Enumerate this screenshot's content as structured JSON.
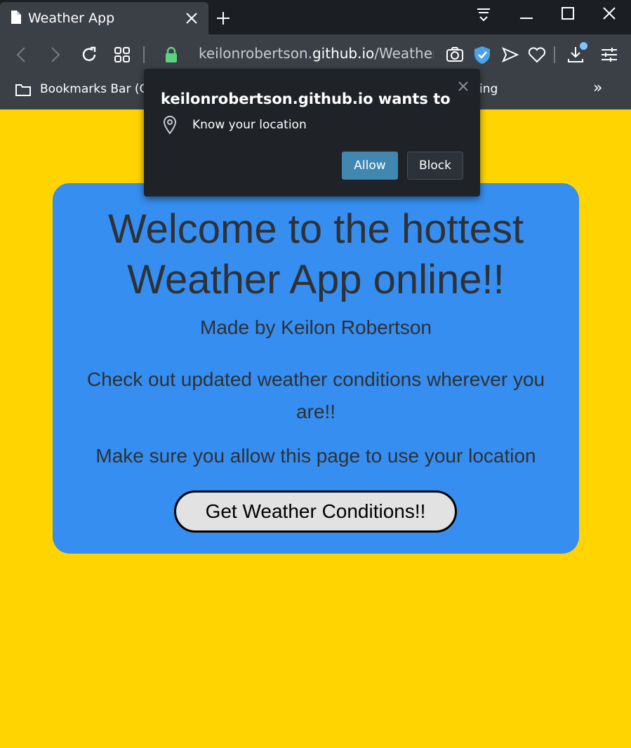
{
  "browser": {
    "tab_title": "Weather App",
    "url_prefix": "keilonrobertson.",
    "url_domain": "github.io",
    "url_path": "/WeatherA",
    "bookmarks_label": "Bookmarks Bar (Ch",
    "bookmarks_trailing": "ing",
    "overflow_label": "»"
  },
  "permission_popup": {
    "title": "keilonrobertson.github.io wants to",
    "request": "Know your location",
    "allow_label": "Allow",
    "block_label": "Block"
  },
  "page": {
    "headline": "Welcome to the hottest Weather App online!!",
    "byline": "Made by Keilon Robertson",
    "description": "Check out updated weather conditions wherever you are!!",
    "instruction": "Make sure you allow this page to use your location",
    "button_label": "Get Weather Conditions!!"
  },
  "colors": {
    "page_background": "#ffd400",
    "card_background": "#358ef0",
    "allow_button": "#4187b0",
    "chrome_dark": "#1b1e22",
    "chrome_toolbar": "#3b4047"
  }
}
